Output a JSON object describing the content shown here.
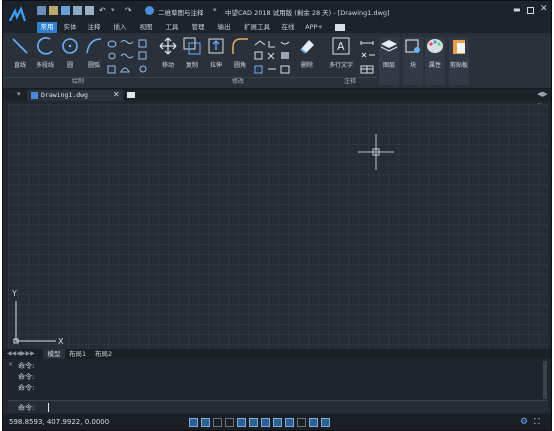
{
  "title": "中望CAD 2018 试用版 (剩余 28 天) - [Drawing1.dwg]",
  "workspace": "二维草图与注释",
  "ribbon_tabs": [
    "常用",
    "实体",
    "注释",
    "插入",
    "视图",
    "工具",
    "管理",
    "输出",
    "扩展工具",
    "在线",
    "APP+"
  ],
  "draw_tools": {
    "line": "直线",
    "polyline": "多段线",
    "circle": "圆",
    "arc": "圆弧"
  },
  "modify_tools": {
    "move": "移动",
    "copy": "复制",
    "stretch": "拉伸",
    "fillet": "圆角",
    "erase": "删除"
  },
  "annot_tools": {
    "mtext": "多行文字"
  },
  "other_tools": {
    "layer": "图层",
    "block": "块",
    "properties": "属性",
    "clipboard": "剪贴板"
  },
  "panels": {
    "draw": "绘制",
    "modify": "修改",
    "annotate": "注释"
  },
  "document_tab": "Drawing1.dwg",
  "layout_tabs": [
    "模型",
    "布局1",
    "布局2"
  ],
  "command_lines": [
    "命令:",
    "命令:",
    "命令:"
  ],
  "command_prompt": "命令:",
  "coordinates": "598.8593, 407.9922, 0.0000",
  "axis": {
    "x": "X",
    "y": "Y"
  },
  "colors": {
    "accent": "#2f7fd0",
    "canvas": "#252c35"
  }
}
